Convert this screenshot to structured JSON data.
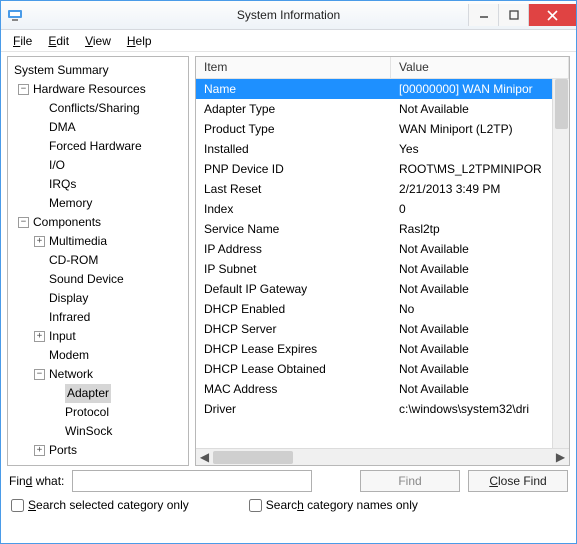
{
  "window": {
    "title": "System Information"
  },
  "menu": {
    "file": "File",
    "edit": "Edit",
    "view": "View",
    "help": "Help"
  },
  "tree": {
    "root": "System Summary",
    "hardware_resources": "Hardware Resources",
    "hr": {
      "conflicts": "Conflicts/Sharing",
      "dma": "DMA",
      "forced": "Forced Hardware",
      "io": "I/O",
      "irqs": "IRQs",
      "memory": "Memory"
    },
    "components": "Components",
    "comp": {
      "multimedia": "Multimedia",
      "cdrom": "CD-ROM",
      "sound": "Sound Device",
      "display": "Display",
      "infrared": "Infrared",
      "input": "Input",
      "modem": "Modem",
      "network": "Network",
      "net": {
        "adapter": "Adapter",
        "protocol": "Protocol",
        "winsock": "WinSock"
      },
      "ports": "Ports"
    }
  },
  "list": {
    "header_item": "Item",
    "header_value": "Value",
    "rows": [
      {
        "item": "Name",
        "value": "[00000000] WAN Minipor"
      },
      {
        "item": "Adapter Type",
        "value": "Not Available"
      },
      {
        "item": "Product Type",
        "value": "WAN Miniport (L2TP)"
      },
      {
        "item": "Installed",
        "value": "Yes"
      },
      {
        "item": "PNP Device ID",
        "value": "ROOT\\MS_L2TPMINIPOR"
      },
      {
        "item": "Last Reset",
        "value": "2/21/2013 3:49 PM"
      },
      {
        "item": "Index",
        "value": "0"
      },
      {
        "item": "Service Name",
        "value": "Rasl2tp"
      },
      {
        "item": "IP Address",
        "value": "Not Available"
      },
      {
        "item": "IP Subnet",
        "value": "Not Available"
      },
      {
        "item": "Default IP Gateway",
        "value": "Not Available"
      },
      {
        "item": "DHCP Enabled",
        "value": "No"
      },
      {
        "item": "DHCP Server",
        "value": "Not Available"
      },
      {
        "item": "DHCP Lease Expires",
        "value": "Not Available"
      },
      {
        "item": "DHCP Lease Obtained",
        "value": "Not Available"
      },
      {
        "item": "MAC Address",
        "value": "Not Available"
      },
      {
        "item": "Driver",
        "value": "c:\\windows\\system32\\dri"
      }
    ]
  },
  "find": {
    "label": "Find what:",
    "value": "",
    "find_btn": "Find",
    "close_btn": "Close Find",
    "cb1": "Search selected category only",
    "cb2": "Search category names only"
  }
}
